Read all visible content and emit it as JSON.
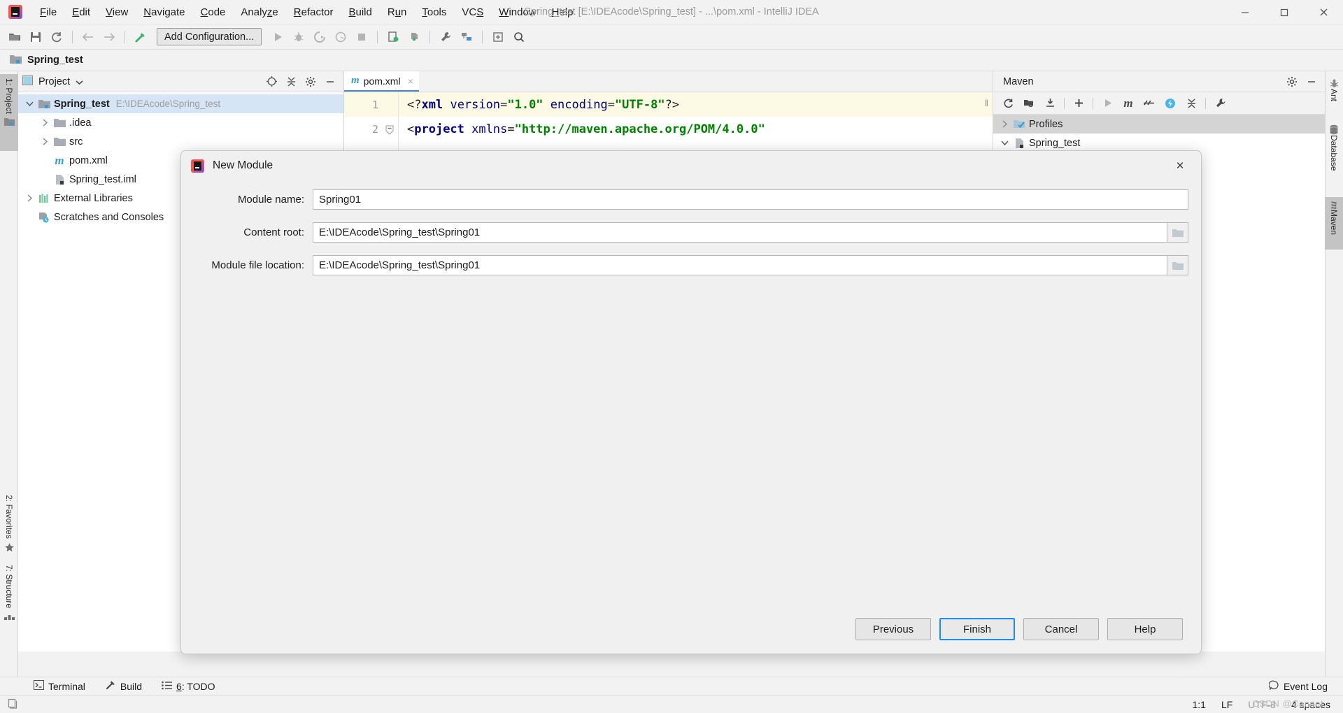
{
  "window": {
    "title": "Spring_test [E:\\IDEAcode\\Spring_test] - ...\\pom.xml - IntelliJ IDEA",
    "logo_name": "intellij-idea-logo"
  },
  "menubar": {
    "items": [
      {
        "label": "File",
        "mnemonic": "F"
      },
      {
        "label": "Edit",
        "mnemonic": "E"
      },
      {
        "label": "View",
        "mnemonic": "V"
      },
      {
        "label": "Navigate",
        "mnemonic": "N"
      },
      {
        "label": "Code",
        "mnemonic": "C"
      },
      {
        "label": "Analyze",
        "mnemonic": "z"
      },
      {
        "label": "Refactor",
        "mnemonic": "R"
      },
      {
        "label": "Build",
        "mnemonic": "B"
      },
      {
        "label": "Run",
        "mnemonic": "u"
      },
      {
        "label": "Tools",
        "mnemonic": "T"
      },
      {
        "label": "VCS",
        "mnemonic": "S"
      },
      {
        "label": "Window",
        "mnemonic": "W"
      },
      {
        "label": "Help",
        "mnemonic": "H"
      }
    ]
  },
  "toolbar": {
    "add_configuration_label": "Add Configuration...",
    "icons": [
      "open-folder-icon",
      "save-icon",
      "sync-icon",
      "back-arrow-icon",
      "forward-arrow-icon",
      "build-hammer-icon",
      "run-icon",
      "debug-icon",
      "run-coverage-icon",
      "profile-icon",
      "stop-icon",
      "update-project-icon",
      "commit-icon",
      "settings-wrench-icon",
      "project-structure-icon",
      "select-target-icon",
      "search-icon"
    ]
  },
  "breadcrumb": {
    "label": "Spring_test"
  },
  "left_stripe": {
    "tabs": [
      {
        "label": "1: Project",
        "active": true,
        "icon": "project-folder-icon"
      },
      {
        "label": "2: Favorites",
        "active": false,
        "icon": "star-icon"
      },
      {
        "label": "7: Structure",
        "active": false,
        "icon": "structure-icon"
      }
    ]
  },
  "right_stripe": {
    "tabs": [
      {
        "label": "Ant",
        "active": false,
        "icon": "ant-icon"
      },
      {
        "label": "Database",
        "active": false,
        "icon": "database-icon"
      },
      {
        "label": "Maven",
        "active": true,
        "icon": "maven-m-icon"
      }
    ]
  },
  "project_panel": {
    "title": "Project",
    "actions": [
      "locate-target-icon",
      "collapse-all-icon",
      "gear-icon",
      "minimize-icon"
    ],
    "tree": [
      {
        "label": "Spring_test",
        "path": "E:\\IDEAcode\\Spring_test",
        "depth": 0,
        "bold": true,
        "expanded": true,
        "selected": true,
        "icon": "module-folder-icon"
      },
      {
        "label": ".idea",
        "path": "",
        "depth": 1,
        "bold": false,
        "expanded": false,
        "selected": false,
        "icon": "folder-icon"
      },
      {
        "label": "src",
        "path": "",
        "depth": 1,
        "bold": false,
        "expanded": false,
        "selected": false,
        "icon": "folder-icon"
      },
      {
        "label": "pom.xml",
        "path": "",
        "depth": 1,
        "bold": false,
        "expanded": null,
        "selected": false,
        "icon": "maven-m-icon"
      },
      {
        "label": "Spring_test.iml",
        "path": "",
        "depth": 1,
        "bold": false,
        "expanded": null,
        "selected": false,
        "icon": "iml-file-icon"
      },
      {
        "label": "External Libraries",
        "path": "",
        "depth": 0,
        "bold": false,
        "expanded": false,
        "selected": false,
        "icon": "libraries-icon"
      },
      {
        "label": "Scratches and Consoles",
        "path": "",
        "depth": 0,
        "bold": false,
        "expanded": null,
        "selected": false,
        "icon": "scratches-icon"
      }
    ]
  },
  "editor": {
    "tab": {
      "label": "pom.xml",
      "icon": "maven-m-icon",
      "close": "×"
    },
    "lines": [
      {
        "number": "1",
        "current": true,
        "fold": false,
        "tokens": [
          {
            "t": "<?",
            "c": "punct"
          },
          {
            "t": "xml",
            "c": "tag"
          },
          {
            "t": " ",
            "c": "punct"
          },
          {
            "t": "version",
            "c": "attr"
          },
          {
            "t": "=",
            "c": "punct"
          },
          {
            "t": "\"1.0\"",
            "c": "val"
          },
          {
            "t": " ",
            "c": "punct"
          },
          {
            "t": "encoding",
            "c": "attr"
          },
          {
            "t": "=",
            "c": "punct"
          },
          {
            "t": "\"UTF-8\"",
            "c": "val"
          },
          {
            "t": "?>",
            "c": "punct"
          }
        ]
      },
      {
        "number": "2",
        "current": false,
        "fold": true,
        "tokens": [
          {
            "t": "<",
            "c": "punct"
          },
          {
            "t": "project",
            "c": "tag"
          },
          {
            "t": " ",
            "c": "punct"
          },
          {
            "t": "xmlns",
            "c": "attr"
          },
          {
            "t": "=",
            "c": "punct"
          },
          {
            "t": "\"http://maven.apache.org/POM/4.0.0\"",
            "c": "val"
          }
        ]
      }
    ]
  },
  "maven_panel": {
    "title": "Maven",
    "head_actions": [
      "gear-icon",
      "minimize-icon"
    ],
    "toolbar_icons": [
      "reimport-icon",
      "generate-sources-icon",
      "download-sources-icon",
      "add-maven-project-icon",
      "run-icon",
      "execute-maven-goal-icon",
      "toggle-skip-tests-icon",
      "toggle-offline-icon",
      "collapse-all-icon",
      "settings-wrench-icon"
    ],
    "tree": [
      {
        "label": "Profiles",
        "selected": true,
        "expanded": false,
        "icon": "profiles-icon"
      },
      {
        "label": "Spring_test",
        "selected": false,
        "expanded": true,
        "icon": "maven-project-icon"
      }
    ]
  },
  "bottom_bar": {
    "items": [
      {
        "label": "Terminal",
        "icon": "terminal-icon",
        "mnemonic": ""
      },
      {
        "label": "Build",
        "icon": "build-hammer-icon",
        "mnemonic": ""
      },
      {
        "label": "6: TODO",
        "icon": "todo-list-icon",
        "mnemonic": "6"
      }
    ],
    "event_log": {
      "label": "Event Log",
      "icon": "event-log-icon"
    }
  },
  "status_bar": {
    "caret": "1:1",
    "line_separator": "LF",
    "encoding": "UTF-8",
    "indent": "4 spaces",
    "lock_icon": "lock-icon",
    "watermark": "CSDN @Cannet"
  },
  "dialog": {
    "title": "New Module",
    "close_label": "×",
    "fields": [
      {
        "label": "Module name:",
        "value": "Spring01",
        "browse": false,
        "name": "module-name"
      },
      {
        "label": "Content root:",
        "value": "E:\\IDEAcode\\Spring_test\\Spring01",
        "browse": true,
        "name": "content-root"
      },
      {
        "label": "Module file location:",
        "value": "E:\\IDEAcode\\Spring_test\\Spring01",
        "browse": true,
        "name": "module-file-location"
      }
    ],
    "buttons": [
      {
        "label": "Previous",
        "default": false,
        "name": "previous"
      },
      {
        "label": "Finish",
        "default": true,
        "name": "finish"
      },
      {
        "label": "Cancel",
        "default": false,
        "name": "cancel"
      },
      {
        "label": "Help",
        "default": false,
        "name": "help"
      }
    ]
  },
  "colors": {
    "accent_blue": "#1a8cff",
    "selection_blue": "#d6e5f6",
    "tab_underline": "#4a86c8",
    "xml_tag": "#000080",
    "xml_value": "#008000",
    "current_line": "#fcfae4"
  }
}
